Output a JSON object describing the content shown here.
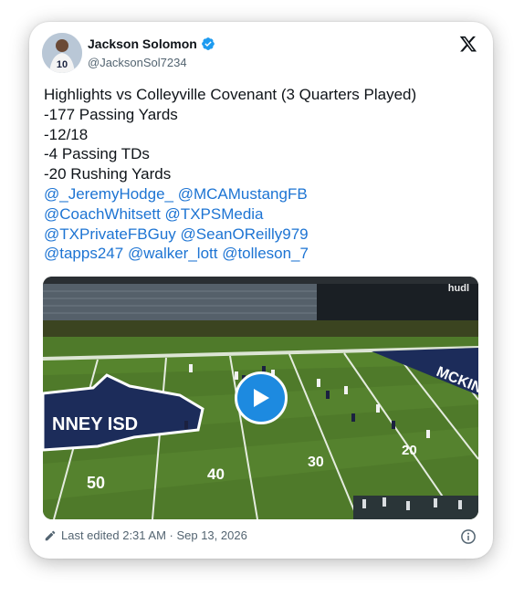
{
  "user": {
    "name": "Jackson Solomon",
    "handle": "@JacksonSol7234",
    "verified": true,
    "avatar_jersey_number": "10"
  },
  "tweet": {
    "lines": [
      "Highlights vs Colleyville Covenant (3 Quarters Played)",
      "-177 Passing Yards",
      "-12/18",
      "-4 Passing TDs",
      "-20 Rushing Yards"
    ],
    "mention_lines": [
      [
        "@_JeremyHodge_",
        "@MCAMustangFB"
      ],
      [
        "@CoachWhitsett",
        "@TXPSMedia"
      ],
      [
        "@TXPrivateFBGuy",
        "@SeanOReilly979"
      ],
      [
        "@tapps247",
        "@walker_lott",
        "@tolleson_7"
      ]
    ]
  },
  "media": {
    "watermark": "hudl",
    "field_numbers": [
      "50",
      "40",
      "30",
      "20"
    ],
    "logo_text": "NNEY ISD",
    "endzone_text": "MCKINN"
  },
  "footer": {
    "edited_text": "Last edited 2:31 AM · Sep 13, 2026"
  },
  "colors": {
    "mention": "#1d74d3",
    "verified": "#1d9bf0",
    "play_button": "#1d8ae0"
  },
  "icons": [
    "verified-badge-icon",
    "x-logo-icon",
    "play-icon",
    "pencil-icon",
    "info-icon"
  ]
}
